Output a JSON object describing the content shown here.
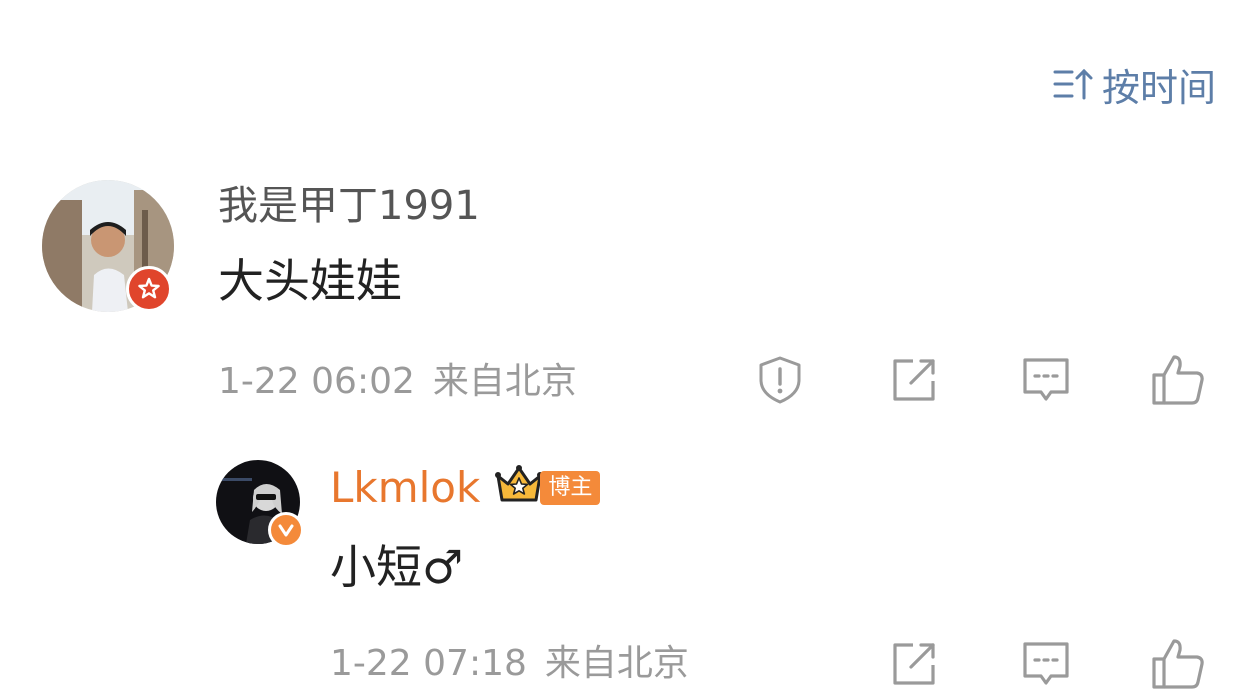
{
  "sort": {
    "label": "按时间",
    "icon": "sort-time-icon"
  },
  "comments": [
    {
      "username": "我是甲丁1991",
      "content": "大头娃娃",
      "time": "1-22 06:02",
      "location": "来自北京",
      "avatar_badge": "star-badge-icon",
      "actions": [
        "report-icon",
        "share-icon",
        "comment-icon",
        "like-icon"
      ]
    }
  ],
  "replies": [
    {
      "username": "Lkmlok",
      "tag": "博主",
      "content": "小短♂",
      "time": "1-22 07:18",
      "location": "来自北京",
      "avatar_badge": "verified-v-icon",
      "actions": [
        "share-icon",
        "comment-icon",
        "like-icon"
      ]
    }
  ],
  "colors": {
    "link_blue": "#5d7ea8",
    "username_gray": "#555555",
    "username_orange": "#e8772e",
    "meta_gray": "#9a9a9a",
    "badge_red": "#e0452c",
    "badge_orange": "#f48a3a"
  }
}
